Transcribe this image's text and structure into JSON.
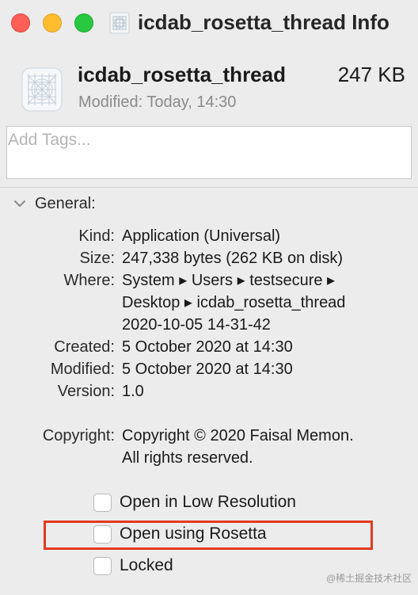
{
  "window": {
    "title": "icdab_rosetta_thread Info",
    "title_icon": "document-icon"
  },
  "header": {
    "app_icon": "application-icon",
    "name": "icdab_rosetta_thread",
    "size": "247 KB",
    "modified": "Modified: Today, 14:30"
  },
  "tags": {
    "placeholder": "Add Tags...",
    "value": ""
  },
  "general": {
    "section_label": "General:",
    "disclosure_icon": "chevron-down-icon",
    "kind_label": "Kind:",
    "kind_value": "Application (Universal)",
    "size_label": "Size:",
    "size_value": "247,338 bytes (262 KB on disk)",
    "where_label": "Where:",
    "where_line1": "System ▸ Users ▸ testsecure ▸",
    "where_line2": "Desktop ▸ icdab_rosetta_thread",
    "where_line3": "2020-10-05 14-31-42",
    "created_label": "Created:",
    "created_value": "5 October 2020 at 14:30",
    "modified_label": "Modified:",
    "modified_value": "5 October 2020 at 14:30",
    "version_label": "Version:",
    "version_value": "1.0",
    "copyright_label": "Copyright:",
    "copyright_line1": "Copyright © 2020 Faisal Memon.",
    "copyright_line2": "All rights reserved."
  },
  "options": {
    "low_resolution": {
      "label": "Open in Low Resolution",
      "checked": false
    },
    "rosetta": {
      "label": "Open using Rosetta",
      "checked": false
    },
    "locked": {
      "label": "Locked",
      "checked": false
    }
  },
  "annotation": {
    "highlight_color": "#e23a21"
  },
  "watermark": "@稀土掘金技术社区"
}
